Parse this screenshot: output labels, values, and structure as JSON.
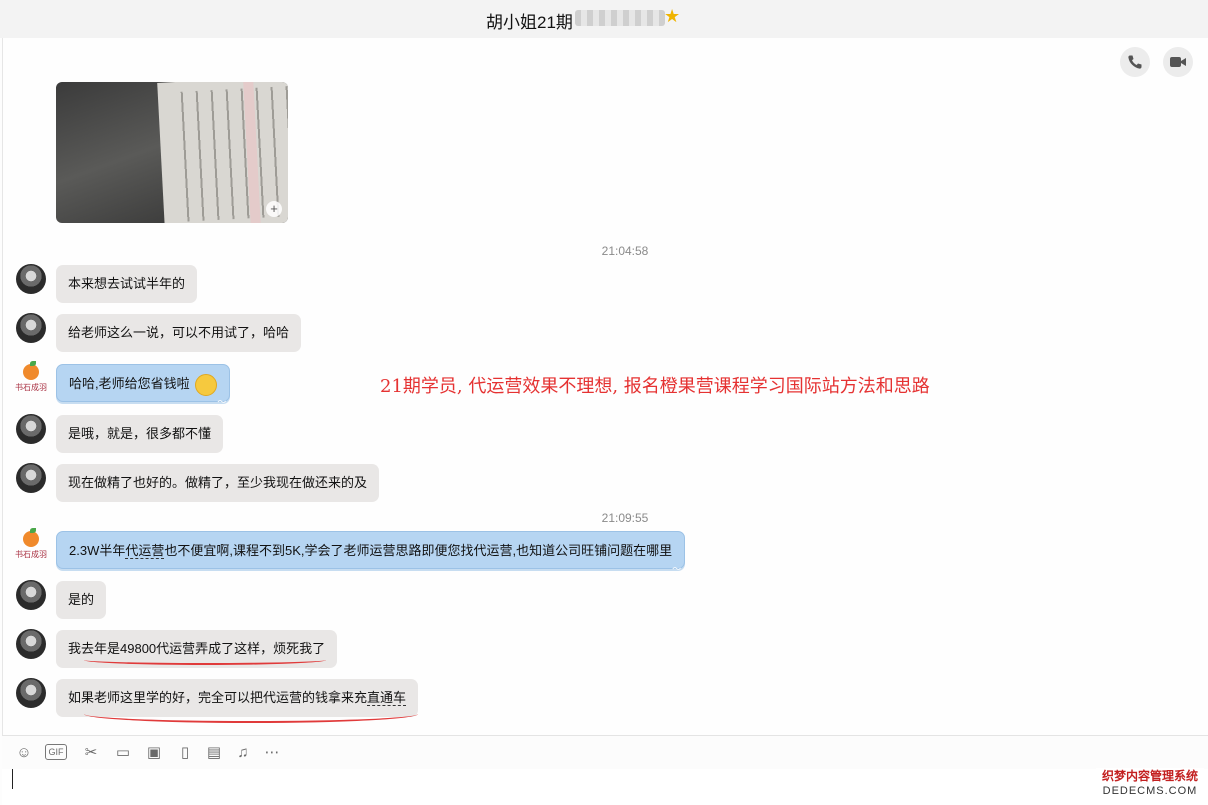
{
  "window": {
    "title": "胡小姐21期"
  },
  "header": {
    "call_icon": "phone-icon",
    "video_icon": "video-icon"
  },
  "messages": {
    "time1": "21:04:58",
    "m1": "本来想去试试半年的",
    "m2": "给老师这么一说，可以不用试了，哈哈",
    "m3": "哈哈,老师给您省钱啦",
    "m4": "是哦，就是，很多都不懂",
    "m5": "现在做精了也好的。做精了，至少我现在做还来的及",
    "time2": "21:09:55",
    "m6_a": "2.3W半年",
    "m6_b": "代运营",
    "m6_c": "也不便宜啊,课程不到5K,学会了老师运营思路即便您找代运营,也知道公司旺铺问题在哪里",
    "m7": "是的",
    "m8": "我去年是49800代运营弄成了这样，烦死我了",
    "m9_a": "如果老师这里学的好，完全可以把代运营的钱拿来充",
    "m9_b": "直通车"
  },
  "brand": {
    "avatar_text": "书石成羽"
  },
  "annotation": "21期学员, 代运营效果不理想, 报名橙果营课程学习国际站方法和思路",
  "toolbar": {
    "gif_label": "GIF",
    "icons": [
      "emoji-icon",
      "gif-icon",
      "scissors-icon",
      "folder-icon",
      "image-icon",
      "video-clip-icon",
      "gift-icon",
      "music-icon",
      "more-icon"
    ]
  },
  "watermark": {
    "line1": "织梦内容管理系统",
    "line2": "DEDECMS.COM"
  },
  "colors": {
    "bubble_gray": "#e9e7e6",
    "bubble_blue": "#b6d5f2",
    "annotation_red": "#e53232"
  }
}
